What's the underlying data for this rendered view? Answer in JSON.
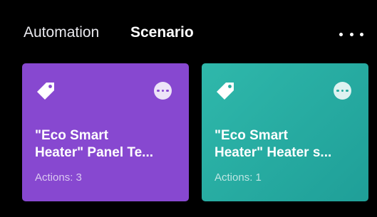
{
  "header": {
    "tabs": [
      {
        "label": "Automation",
        "active": false
      },
      {
        "label": "Scenario",
        "active": true
      }
    ],
    "more_icon": "ellipsis-icon"
  },
  "cards": [
    {
      "title": "\"Eco Smart\nHeater\" Panel Te...",
      "actions": "Actions: 3",
      "color": "#8748d0",
      "icon": "tag-icon",
      "menu_icon": "ellipsis-circle-icon"
    },
    {
      "title": "\"Eco Smart\nHeater\" Heater s...",
      "actions": "Actions: 1",
      "color": "#27ab9f",
      "icon": "tag-icon",
      "menu_icon": "ellipsis-circle-icon"
    }
  ]
}
